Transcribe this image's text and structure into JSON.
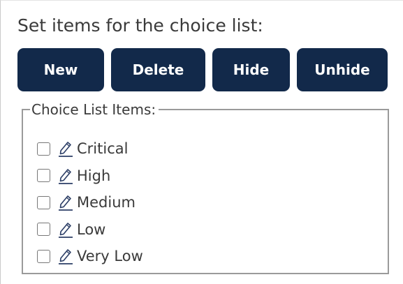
{
  "heading": "Set items for the choice list:",
  "buttons": {
    "new_label": "New",
    "delete_label": "Delete",
    "hide_label": "Hide",
    "unhide_label": "Unhide"
  },
  "choice_list": {
    "legend": "Choice List Items:",
    "items": [
      {
        "label": "Critical",
        "checked": false,
        "icon": "pencil-edit-icon"
      },
      {
        "label": "High",
        "checked": false,
        "icon": "pencil-edit-icon"
      },
      {
        "label": "Medium",
        "checked": false,
        "icon": "pencil-edit-icon"
      },
      {
        "label": "Low",
        "checked": false,
        "icon": "pencil-edit-icon"
      },
      {
        "label": "Very Low",
        "checked": false,
        "icon": "pencil-edit-icon"
      }
    ]
  },
  "colors": {
    "button_background": "#12294a",
    "button_text": "#ffffff",
    "text": "#3a3a3a",
    "groupbox_border": "#9a9a9a"
  }
}
